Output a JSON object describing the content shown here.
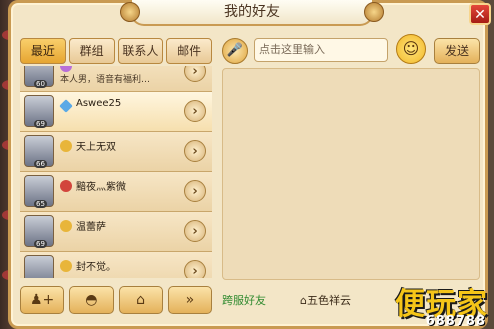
{
  "window": {
    "title": "我的好友",
    "close_label": "✕"
  },
  "tabs": [
    {
      "label": "最近",
      "active": true
    },
    {
      "label": "群组",
      "active": false
    },
    {
      "label": "联系人",
      "active": false
    },
    {
      "label": "邮件",
      "active": false
    }
  ],
  "friends": [
    {
      "name": "…",
      "level": "60",
      "subtitle": "本人男，语音有福利…",
      "icon": "star-badge-icon",
      "icon_color": "#b86fd8"
    },
    {
      "name": "Aswee25",
      "level": "69",
      "subtitle": "",
      "icon": "diamond-badge-icon",
      "icon_color": "#5aa9e6"
    },
    {
      "name": "天上无双",
      "level": "66",
      "subtitle": "",
      "icon": "coin-badge-icon",
      "icon_color": "#e8b53a"
    },
    {
      "name": "黯夜灬紫微",
      "level": "65",
      "subtitle": "",
      "icon": "flower-badge-icon",
      "icon_color": "#d2453c"
    },
    {
      "name": "温蕾萨",
      "level": "69",
      "subtitle": "",
      "icon": "coin-badge-icon",
      "icon_color": "#e8b53a"
    },
    {
      "name": "封不觉。",
      "level": "69",
      "subtitle": "",
      "icon": "coin-badge-icon",
      "icon_color": "#e8b53a"
    }
  ],
  "bottom_buttons": [
    {
      "icon": "add-friend-icon",
      "glyph": "♟+"
    },
    {
      "icon": "shoe-icon",
      "glyph": "◓"
    },
    {
      "icon": "home-icon",
      "glyph": "⌂"
    },
    {
      "icon": "fast-forward-icon",
      "glyph": "»"
    }
  ],
  "chat": {
    "input_placeholder": "点击这里输入",
    "send_label": "发送",
    "mic_glyph": "🎤",
    "smile_glyph": "☺",
    "cross_server_label": "跨服好友",
    "server_name": "五色祥云",
    "server_glyph": "⌂"
  },
  "watermark": {
    "main": "便玩家",
    "number": "688788"
  }
}
